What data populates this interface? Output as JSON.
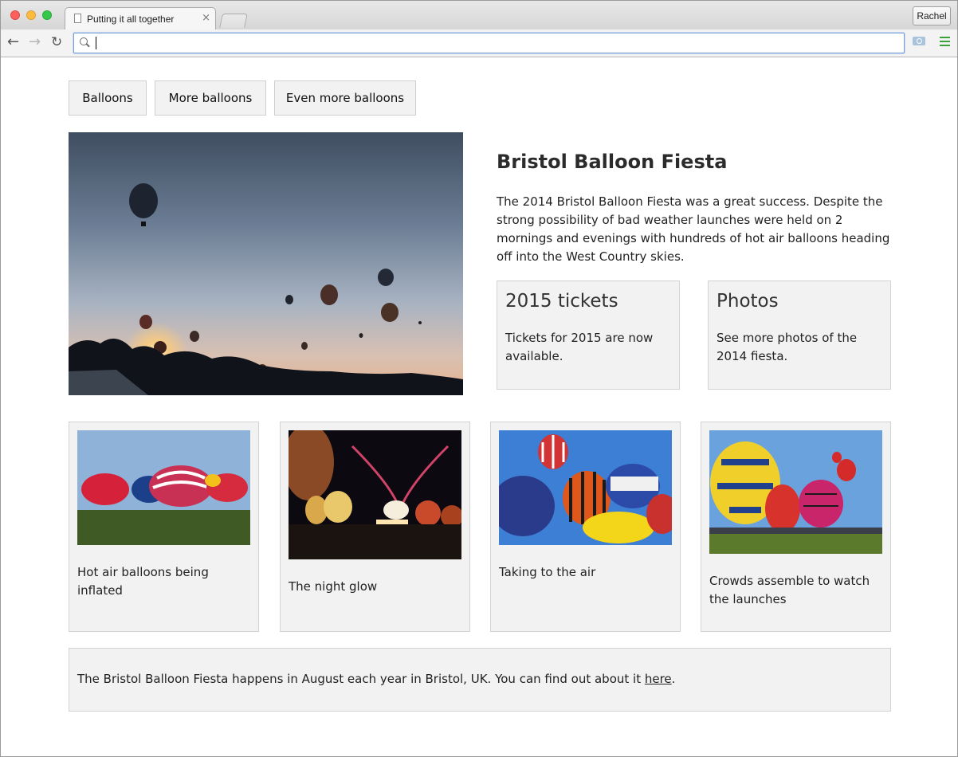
{
  "browser": {
    "tab_title": "Putting it all together",
    "tab_close": "×",
    "profile_name": "Rachel",
    "address_value": ""
  },
  "page": {
    "nav": [
      "Balloons",
      "More balloons",
      "Even more balloons"
    ],
    "article": {
      "title": "Bristol Balloon Fiesta",
      "body": "The 2014 Bristol Balloon Fiesta was a great success. Despite the strong possibility of bad weather launches were held on 2 mornings and evenings with hundreds of hot air balloons heading off into the West Country skies."
    },
    "boxes": [
      {
        "title": "2015 tickets",
        "text": "Tickets for 2015 are now available."
      },
      {
        "title": "Photos",
        "text": "See more photos of the 2014 fiesta."
      }
    ],
    "cards": [
      {
        "caption": "Hot air balloons being inflated"
      },
      {
        "caption": "The night glow"
      },
      {
        "caption": "Taking to the air"
      },
      {
        "caption": "Crowds assemble to watch the launches"
      }
    ],
    "footer": {
      "text": "The Bristol Balloon Fiesta happens in August each year in Bristol, UK. You can find out about it ",
      "link": "here",
      "end": "."
    }
  },
  "colors": {
    "panel_bg": "#f2f2f2",
    "panel_border": "#d3d3d3",
    "omnibox_focus": "#7aa0d8"
  },
  "icons": [
    "page-icon",
    "back-arrow-icon",
    "forward-arrow-icon",
    "reload-icon",
    "search-icon",
    "camera-icon",
    "menu-icon"
  ]
}
